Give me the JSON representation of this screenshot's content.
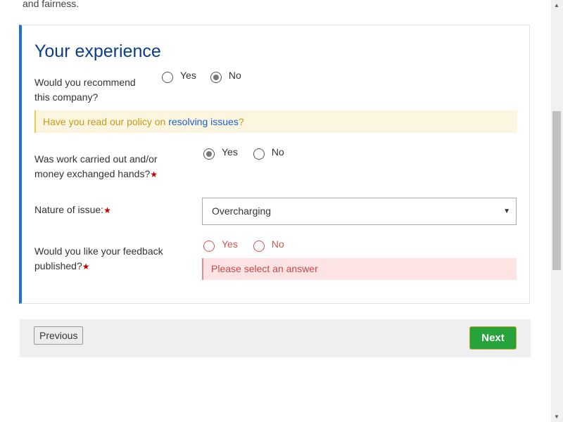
{
  "page": {
    "intro_tail": "and fairness."
  },
  "section": {
    "title": "Your experience",
    "recommend": {
      "label_line1": "Would you recommend",
      "label_line2": "this company?",
      "options": [
        "Yes",
        "No"
      ],
      "selected": "No"
    },
    "notice": {
      "prefix": "Have you read our policy on ",
      "link_text": "resolving issues",
      "suffix": "?"
    },
    "work_carried_out": {
      "label_line1": "Was work carried out and/or",
      "label_line2": "money exchanged hands?",
      "required_marker": "★",
      "options": [
        "Yes",
        "No"
      ],
      "selected": "Yes"
    },
    "nature_of_issue": {
      "label": "Nature of issue:",
      "required_marker": "★",
      "selected_value": "Overcharging",
      "caret": "▼"
    },
    "feedback_published": {
      "label_line1": "Would you like your feedback",
      "label_line2": "published?",
      "required_marker": "★",
      "options": [
        "Yes",
        "No"
      ],
      "selected": null,
      "error": "Please select an answer"
    }
  },
  "footer": {
    "previous_label": "Previous",
    "next_label": "Next"
  },
  "colors": {
    "accent_border": "#1e6ee6",
    "title": "#0a3e8a",
    "next_button": "#26a33a",
    "error_text": "#c74848",
    "notice_bg": "#fcf6e0"
  },
  "scrollbar": {
    "up_arrow": "▲",
    "down_arrow": "▼"
  }
}
